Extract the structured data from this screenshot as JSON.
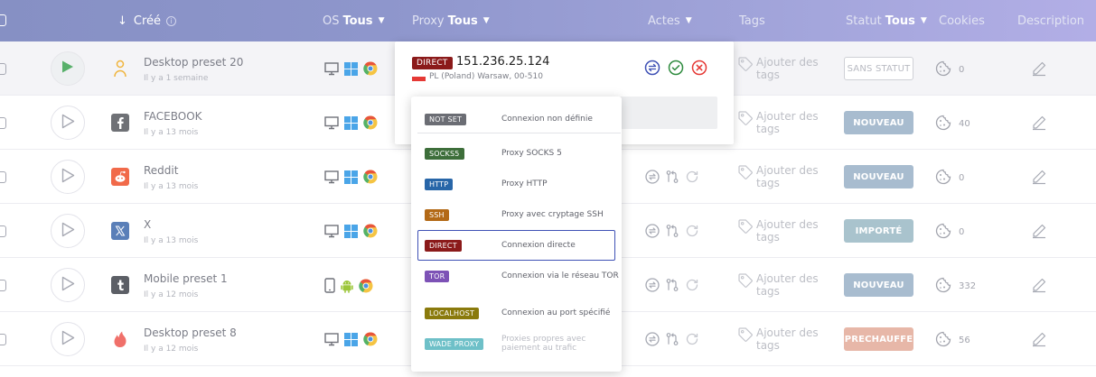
{
  "header": {
    "created_label": "Créé",
    "os_label": "OS",
    "os_filter": "Tous",
    "proxy_label": "Proxy",
    "proxy_filter": "Tous",
    "actions_label": "Actes",
    "tags_label": "Tags",
    "status_label": "Statut",
    "status_filter": "Tous",
    "cookies_label": "Cookies",
    "description_label": "Description"
  },
  "rows": [
    {
      "name": "Desktop preset 20",
      "date": "Il y a 1 semaine",
      "avatar": "person-icon",
      "os": [
        "desktop-icon",
        "windows-icon",
        "chrome-icon"
      ],
      "tags": "Ajouter des tags",
      "status": "SANS STATUT",
      "cookies": "0"
    },
    {
      "name": "FACEBOOK",
      "date": "Il y a 13 mois",
      "avatar": "facebook-icon",
      "os": [
        "desktop-icon",
        "windows-icon",
        "chrome-icon"
      ],
      "tags": "Ajouter des tags",
      "status": "NOUVEAU",
      "cookies": "40"
    },
    {
      "name": "Reddit",
      "date": "Il y a 13 mois",
      "avatar": "reddit-icon",
      "os": [
        "desktop-icon",
        "windows-icon",
        "chrome-icon"
      ],
      "tags": "Ajouter des tags",
      "status": "NOUVEAU",
      "cookies": "0"
    },
    {
      "name": "X",
      "date": "Il y a 13 mois",
      "avatar": "x-icon",
      "os": [
        "desktop-icon",
        "windows-icon",
        "chrome-icon"
      ],
      "tags": "Ajouter des tags",
      "status": "IMPORTÉ",
      "cookies": "0"
    },
    {
      "name": "Mobile preset 1",
      "date": "Il y a 12 mois",
      "avatar": "tumblr-icon",
      "os": [
        "mobile-icon",
        "android-icon",
        "chrome-icon"
      ],
      "tags": "Ajouter des tags",
      "status": "NOUVEAU",
      "cookies": "332"
    },
    {
      "name": "Desktop preset 8",
      "date": "Il y a 12 mois",
      "avatar": "tinder-icon",
      "os": [
        "desktop-icon",
        "windows-icon",
        "chrome-icon"
      ],
      "tags": "Ajouter des tags",
      "status": "PRECHAUFFE",
      "cookies": "56"
    }
  ],
  "proxy_popover": {
    "type": "DIRECT",
    "ip": "151.236.25.124",
    "location": "PL (Poland) Warsaw, 00-510"
  },
  "proxy_dropdown": {
    "options": [
      {
        "tag": "NOT SET",
        "desc": "Connexion non définie",
        "color": "#6b6d74"
      },
      {
        "tag": "SOCKS5",
        "desc": "Proxy SOCKS 5",
        "color": "#3d6e3a"
      },
      {
        "tag": "HTTP",
        "desc": "Proxy HTTP",
        "color": "#2866a8"
      },
      {
        "tag": "SSH",
        "desc": "Proxy avec cryptage SSH",
        "color": "#b36916"
      },
      {
        "tag": "DIRECT",
        "desc": "Connexion directe",
        "color": "#8b1a1a"
      },
      {
        "tag": "TOR",
        "desc": "Connexion via le réseau TOR",
        "color": "#7d52b6"
      },
      {
        "tag": "LOCALHOST",
        "desc": "Connexion au port spécifié",
        "color": "#8a7a0c"
      },
      {
        "tag": "WADE PROXY",
        "desc": "Proxies propres avec paiement au trafic",
        "color": "#6ec0c8"
      }
    ],
    "selected_index": 4
  },
  "status_colors": {
    "NOUVEAU": "#a8bccf",
    "IMPORTÉ": "#a9c3cd",
    "PRECHAUFFE": "#e7b7a8"
  }
}
